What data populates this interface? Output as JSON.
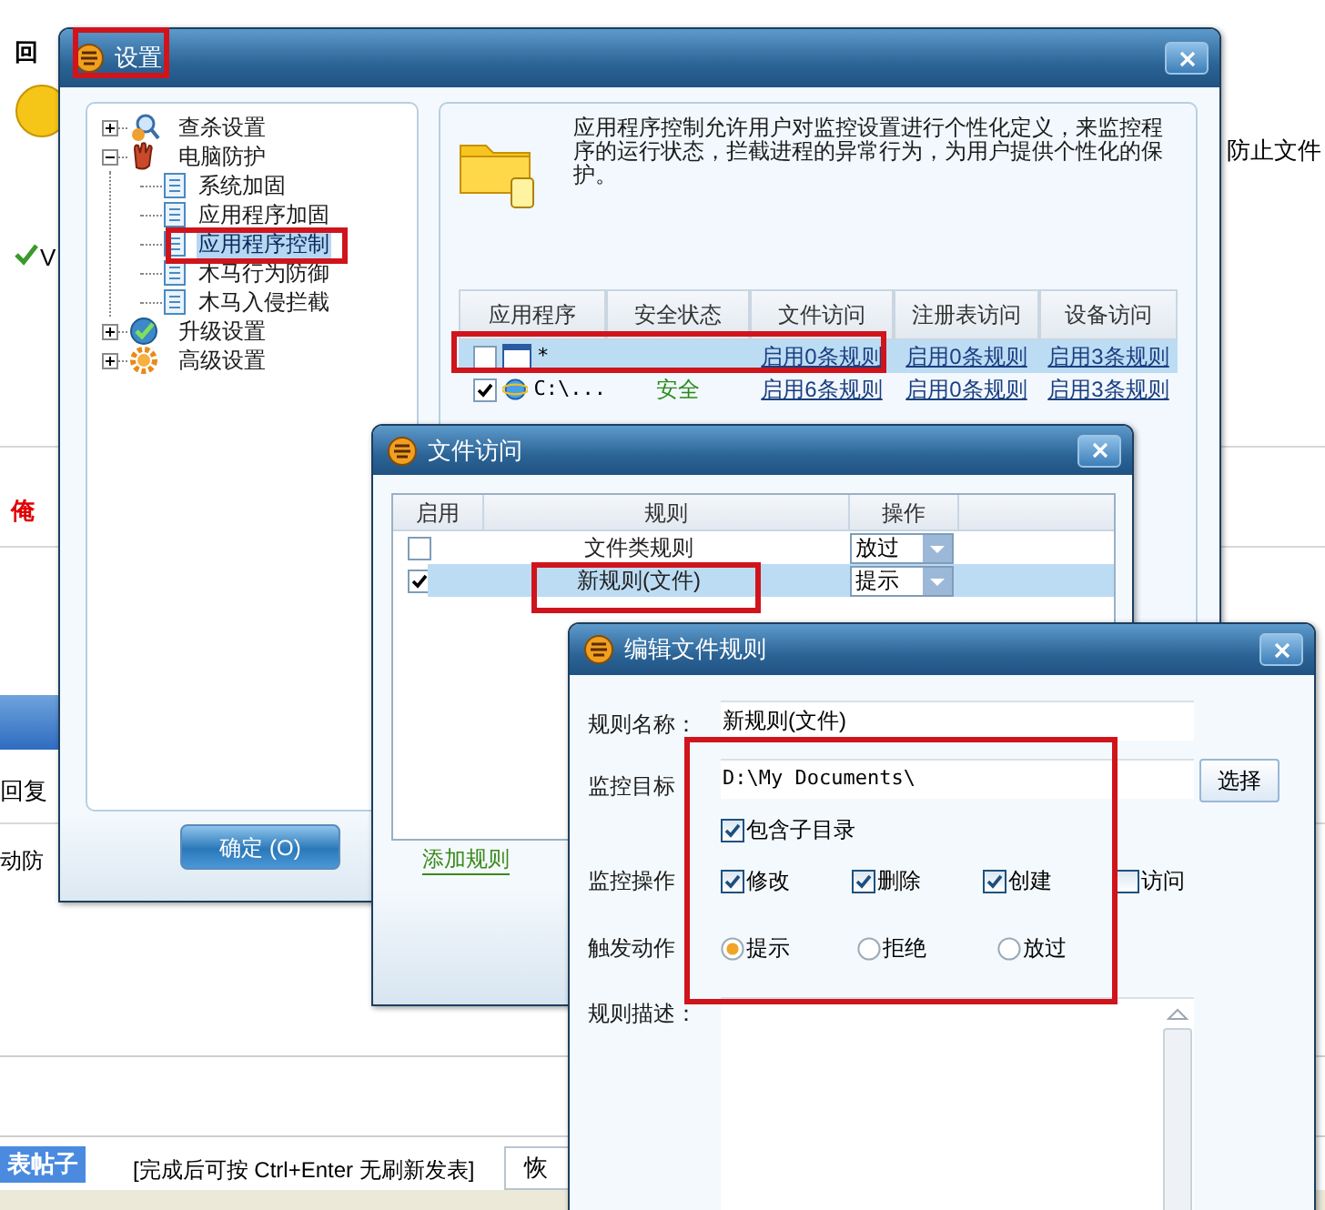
{
  "forum_page": {
    "heading": "回",
    "check_text": "V",
    "notice": "防止文件",
    "author": "俺",
    "reply_label": "回复",
    "defense_text": "动防",
    "post_button": "表帖子",
    "post_hint": "[完成后可按 Ctrl+Enter 无刷新发表]",
    "restore_button": "恢"
  },
  "settings_window": {
    "title": "设置",
    "tree": [
      {
        "label": "查杀设置",
        "expanded": false
      },
      {
        "label": "电脑防护",
        "expanded": true,
        "children": [
          {
            "label": "系统加固",
            "selected": false
          },
          {
            "label": "应用程序加固",
            "selected": false
          },
          {
            "label": "应用程序控制",
            "selected": true
          },
          {
            "label": "木马行为防御",
            "selected": false
          },
          {
            "label": "木马入侵拦截",
            "selected": false
          }
        ]
      },
      {
        "label": "升级设置",
        "expanded": false
      },
      {
        "label": "高级设置",
        "expanded": false
      }
    ],
    "description": "应用程序控制允许用户对监控设置进行个性化定义，来监控程序的运行状态，拦截进程的异常行为，为用户提供个性化的保护。",
    "table": {
      "columns": [
        "应用程序",
        "安全状态",
        "文件访问",
        "注册表访问",
        "设备访问"
      ],
      "rows": [
        {
          "checked": false,
          "selected": true,
          "app": "*",
          "file": "启用0条规则",
          "registry": "启用0条规则",
          "device": "启用3条规则"
        },
        {
          "checked": true,
          "selected": false,
          "app": "C:\\...",
          "status": "安全",
          "file": "启用6条规则",
          "registry": "启用0条规则",
          "device": "启用3条规则"
        }
      ]
    },
    "ok_button": "确定 (O)"
  },
  "file_access_window": {
    "title": "文件访问",
    "columns": [
      "启用",
      "规则",
      "操作"
    ],
    "rows": [
      {
        "checked": false,
        "selected": false,
        "rule": "文件类规则",
        "action": "放过"
      },
      {
        "checked": true,
        "selected": true,
        "rule": "新规则(文件)",
        "action": "提示"
      }
    ],
    "add_link": "添加规则"
  },
  "edit_rule_window": {
    "title": "编辑文件规则",
    "name_label": "规则名称：",
    "name_value": "新规则(文件)",
    "target_label": "监控目标",
    "target_value": "D:\\My Documents\\",
    "choose_button": "选择",
    "include_subdirs": {
      "label": "包含子目录",
      "checked": true
    },
    "operations_label": "监控操作",
    "operations": [
      {
        "label": "修改",
        "checked": true
      },
      {
        "label": "删除",
        "checked": true
      },
      {
        "label": "创建",
        "checked": true
      },
      {
        "label": "访问",
        "checked": false
      }
    ],
    "trigger_label": "触发动作",
    "actions": [
      {
        "label": "提示",
        "selected": true
      },
      {
        "label": "拒绝",
        "selected": false
      },
      {
        "label": "放过",
        "selected": false
      }
    ],
    "description_label": "规则描述："
  }
}
